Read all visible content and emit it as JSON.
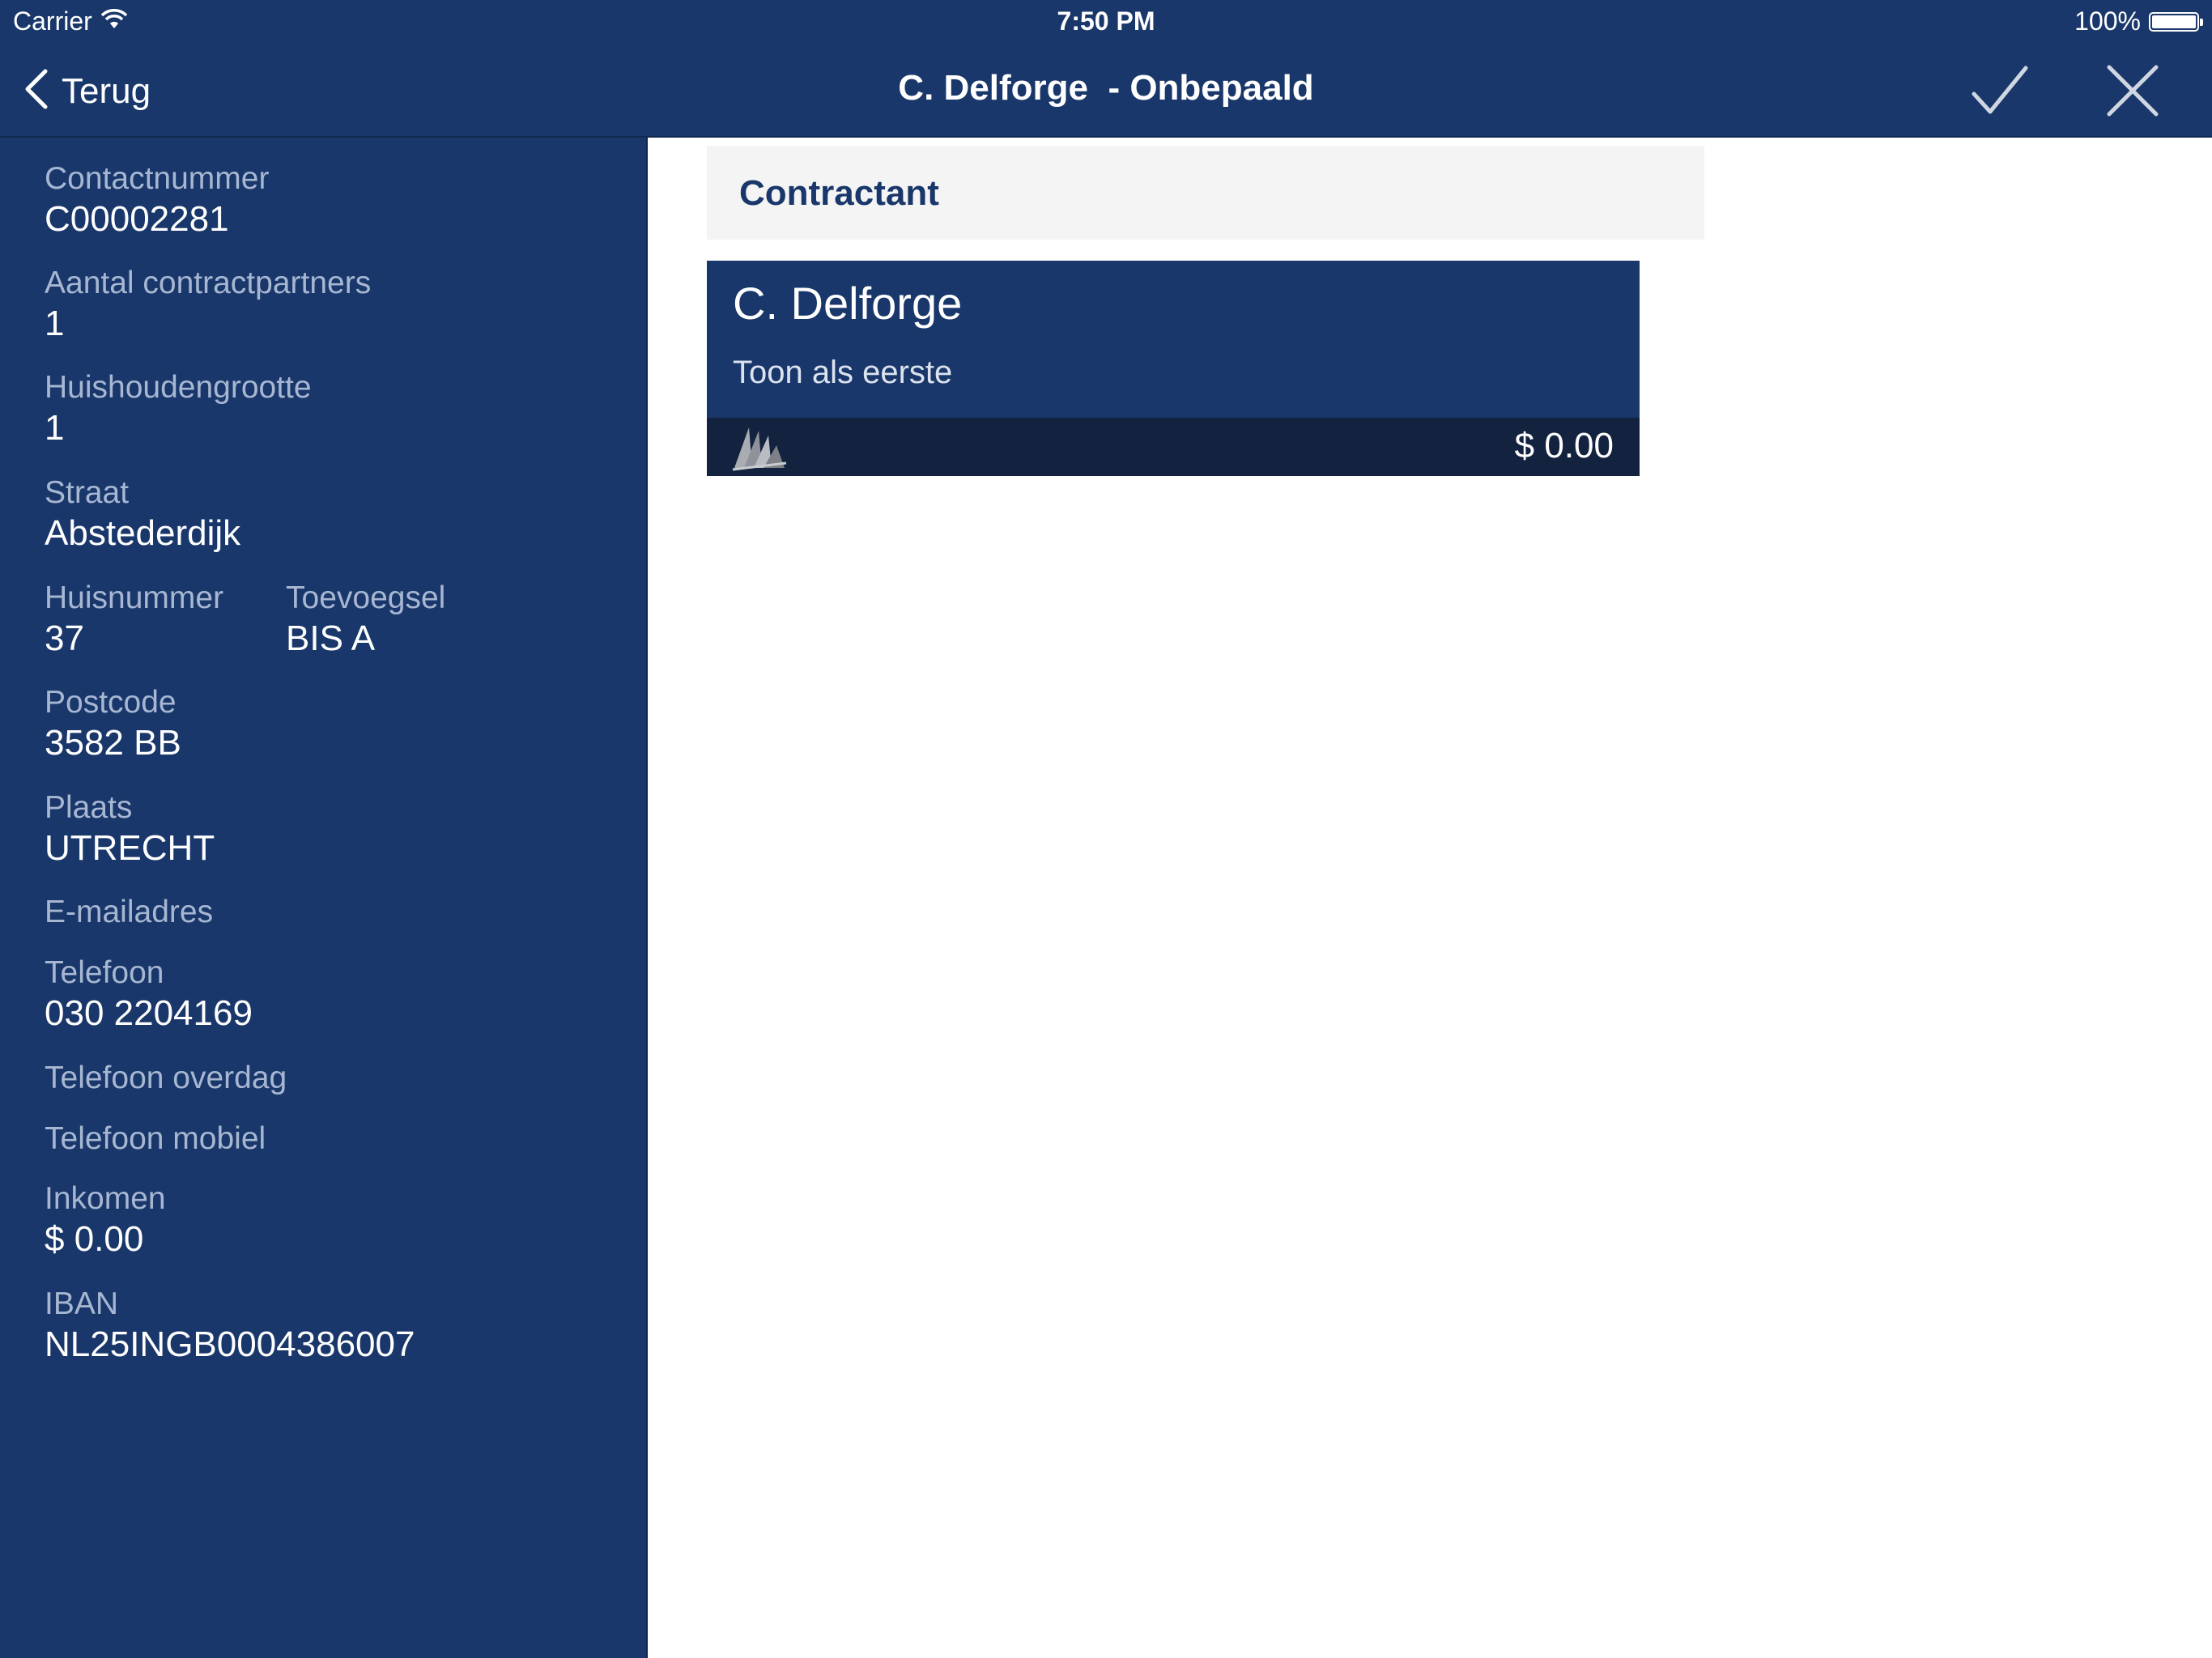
{
  "status_bar": {
    "carrier": "Carrier",
    "time": "7:50 PM",
    "battery": "100%",
    "wifi_icon": "wifi-icon",
    "battery_icon": "battery-icon"
  },
  "nav": {
    "back_label": "Terug",
    "title": "C. Delforge  - Onbepaald",
    "confirm_icon": "checkmark-icon",
    "close_icon": "close-icon"
  },
  "sidebar": {
    "contactnummer": {
      "label": "Contactnummer",
      "value": "C00002281"
    },
    "aantal_contractpartners": {
      "label": "Aantal contractpartners",
      "value": "1"
    },
    "huishoudengrootte": {
      "label": "Huishoudengrootte",
      "value": "1"
    },
    "straat": {
      "label": "Straat",
      "value": "Abstederdijk"
    },
    "huisnummer": {
      "label": "Huisnummer",
      "value": "37"
    },
    "toevoegsel": {
      "label": "Toevoegsel",
      "value": "BIS A"
    },
    "postcode": {
      "label": "Postcode",
      "value": "3582 BB"
    },
    "plaats": {
      "label": "Plaats",
      "value": "UTRECHT"
    },
    "emailadres": {
      "label": "E-mailadres",
      "value": ""
    },
    "telefoon": {
      "label": "Telefoon",
      "value": "030 2204169"
    },
    "telefoon_overdag": {
      "label": "Telefoon overdag",
      "value": ""
    },
    "telefoon_mobiel": {
      "label": "Telefoon mobiel",
      "value": ""
    },
    "inkomen": {
      "label": "Inkomen",
      "value": "$ 0.00"
    },
    "iban": {
      "label": "IBAN",
      "value": "NL25INGB0004386007"
    }
  },
  "main": {
    "section_title": "Contractant",
    "card": {
      "name": "C. Delforge",
      "subtitle": "Toon als eerste",
      "amount": "$ 0.00",
      "logo_icon": "sails-logo-icon"
    }
  },
  "colors": {
    "primary": "#19376a",
    "card_footer": "#13223f",
    "label": "#a7b7d2",
    "section_bg": "#f4f4f4"
  }
}
